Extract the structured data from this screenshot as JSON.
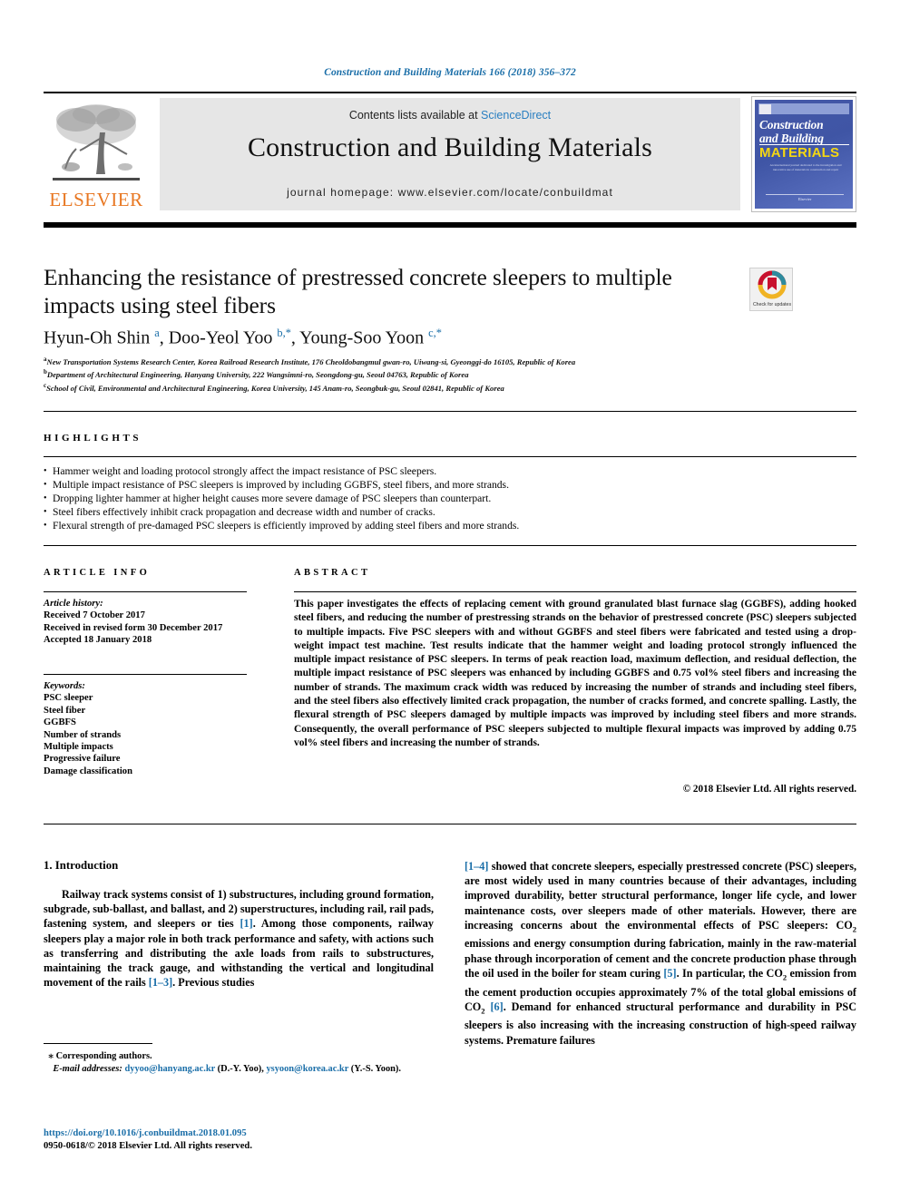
{
  "running_head": "Construction and Building Materials 166 (2018) 356–372",
  "masthead": {
    "publisher_logo_text": "ELSEVIER",
    "contents_prefix": "Contents lists available at ",
    "contents_link": "ScienceDirect",
    "journal_title": "Construction and Building Materials",
    "homepage": "journal homepage: www.elsevier.com/locate/conbuildmat",
    "cover": {
      "line1": "Construction",
      "line2": "and Building",
      "line3": "MATERIALS",
      "blurb": "An international journal dedicated to the investigation and innovative use of materials in construction and repair",
      "footer": "Elsevier"
    }
  },
  "article": {
    "title": "Enhancing the resistance of prestressed concrete sleepers to multiple impacts using steel fibers",
    "crossmark": "Check for updates",
    "authors_html": "Hyun-Oh Shin <sup class=\"aff-link\">a</sup>, Doo-Yeol Yoo <sup class=\"aff-link\">b,*</sup>, Young-Soo Yoon <sup class=\"aff-link\">c,*</sup>",
    "affiliations": [
      {
        "marker": "a",
        "text": "New Transportation Systems Research Center, Korea Railroad Research Institute, 176 Cheoldobangmul gwan-ro, Uiwang-si, Gyeonggi-do 16105, Republic of Korea"
      },
      {
        "marker": "b",
        "text": "Department of Architectural Engineering, Hanyang University, 222 Wangsimni-ro, Seongdong-gu, Seoul 04763, Republic of Korea"
      },
      {
        "marker": "c",
        "text": "School of Civil, Environmental and Architectural Engineering, Korea University, 145 Anam-ro, Seongbuk-gu, Seoul 02841, Republic of Korea"
      }
    ]
  },
  "highlights": {
    "heading": "HIGHLIGHTS",
    "items": [
      "Hammer weight and loading protocol strongly affect the impact resistance of PSC sleepers.",
      "Multiple impact resistance of PSC sleepers is improved by including GGBFS, steel fibers, and more strands.",
      "Dropping lighter hammer at higher height causes more severe damage of PSC sleepers than counterpart.",
      "Steel fibers effectively inhibit crack propagation and decrease width and number of cracks.",
      "Flexural strength of pre-damaged PSC sleepers is efficiently improved by adding steel fibers and more strands."
    ]
  },
  "article_info": {
    "heading": "ARTICLE INFO",
    "history_label": "Article history:",
    "history": [
      "Received 7 October 2017",
      "Received in revised form 30 December 2017",
      "Accepted 18 January 2018"
    ],
    "keywords_label": "Keywords:",
    "keywords": [
      "PSC sleeper",
      "Steel fiber",
      "GGBFS",
      "Number of strands",
      "Multiple impacts",
      "Progressive failure",
      "Damage classification"
    ]
  },
  "abstract": {
    "heading": "ABSTRACT",
    "text": "This paper investigates the effects of replacing cement with ground granulated blast furnace slag (GGBFS), adding hooked steel fibers, and reducing the number of prestressing strands on the behavior of prestressed concrete (PSC) sleepers subjected to multiple impacts. Five PSC sleepers with and without GGBFS and steel fibers were fabricated and tested using a drop-weight impact test machine. Test results indicate that the hammer weight and loading protocol strongly influenced the multiple impact resistance of PSC sleepers. In terms of peak reaction load, maximum deflection, and residual deflection, the multiple impact resistance of PSC sleepers was enhanced by including GGBFS and 0.75 vol% steel fibers and increasing the number of strands. The maximum crack width was reduced by increasing the number of strands and including steel fibers, and the steel fibers also effectively limited crack propagation, the number of cracks formed, and concrete spalling. Lastly, the flexural strength of PSC sleepers damaged by multiple impacts was improved by including steel fibers and more strands. Consequently, the overall performance of PSC sleepers subjected to multiple flexural impacts was improved by adding 0.75 vol% steel fibers and increasing the number of strands.",
    "copyright": "© 2018 Elsevier Ltd. All rights reserved."
  },
  "body": {
    "section_heading": "1. Introduction",
    "left_column_html": "Railway track systems consist of 1) substructures, including ground formation, subgrade, sub-ballast, and ballast, and 2) superstructures, including rail, rail pads, fastening system, and sleepers or ties <span class=\"ref\">[1]</span>. Among those components, railway sleepers play a major role in both track performance and safety, with actions such as transferring and distributing the axle loads from rails to substructures, maintaining the track gauge, and withstanding the vertical and longitudinal movement of the rails <span class=\"ref\">[1–3]</span>. Previous studies",
    "right_column_html": "<span class=\"ref\">[1–4]</span> showed that concrete sleepers, especially prestressed concrete (PSC) sleepers, are most widely used in many countries because of their advantages, including improved durability, better structural performance, longer life cycle, and lower maintenance costs, over sleepers made of other materials. However, there are increasing concerns about the environmental effects of PSC sleepers: CO<sub>2</sub> emissions and energy consumption during fabrication, mainly in the raw-material phase through incorporation of cement and the concrete production phase through the oil used in the boiler for steam curing <span class=\"ref\">[5]</span>. In particular, the CO<sub>2</sub> emission from the cement production occupies approximately 7% of the total global emissions of CO<sub>2</sub> <span class=\"ref\">[6]</span>. Demand for enhanced structural performance and durability in PSC sleepers is also increasing with the increasing construction of high-speed railway systems. Premature failures"
  },
  "footer": {
    "corresponding_note": "Corresponding authors.",
    "email_label": "E-mail addresses:",
    "email1": "dyyoo@hanyang.ac.kr",
    "email1_name": "(D.-Y. Yoo),",
    "email2": "ysyoon@korea.ac.kr",
    "email2_name": "(Y.-S. Yoon).",
    "doi": "https://doi.org/10.1016/j.conbuildmat.2018.01.095",
    "issn": "0950-0618/© 2018 Elsevier Ltd. All rights reserved."
  },
  "colors": {
    "link": "#1a6ea8",
    "elsevier_orange": "#E87722",
    "cover_blue": "#4558a8"
  }
}
